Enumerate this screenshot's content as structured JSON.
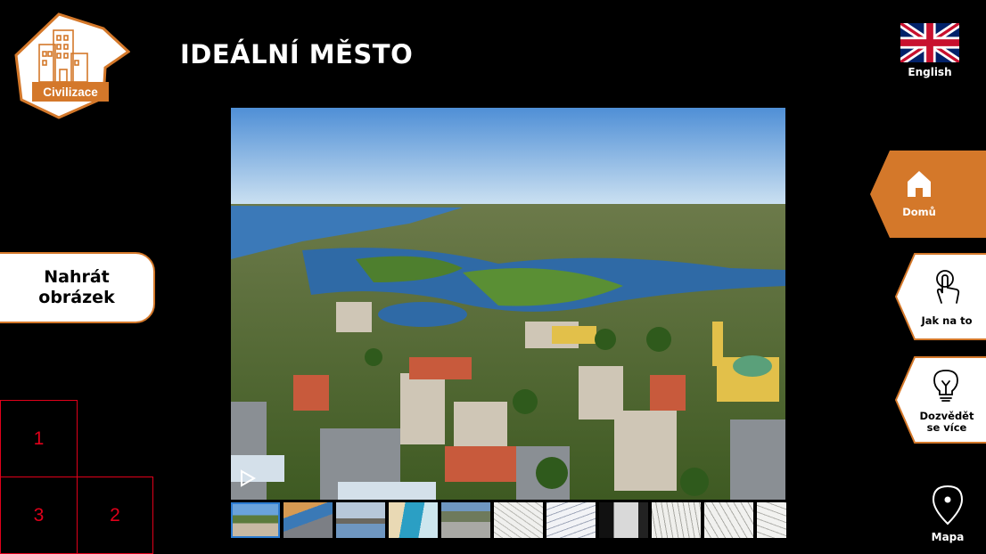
{
  "logo": {
    "label": "Civilizace"
  },
  "header": {
    "title": "IDEÁLNÍ MĚSTO"
  },
  "language": {
    "label": "English"
  },
  "upload": {
    "label": "Nahrát\nobrázek"
  },
  "grid": {
    "cells": [
      "1",
      "3",
      "2"
    ]
  },
  "nav": {
    "home": "Domů",
    "howto": "Jak na to",
    "learn": "Dozvědět\nse více",
    "map": "Mapa"
  },
  "colors": {
    "accent": "#d4782a",
    "grid": "#e0001a",
    "active_thumb": "#2d7dd2"
  },
  "icons": [
    "buildings-icon",
    "uk-flag-icon",
    "home-icon",
    "touch-hand-icon",
    "lightbulb-icon",
    "map-pin-icon",
    "play-icon"
  ],
  "gallery": {
    "thumbnail_count": 11,
    "active_index": 0
  }
}
